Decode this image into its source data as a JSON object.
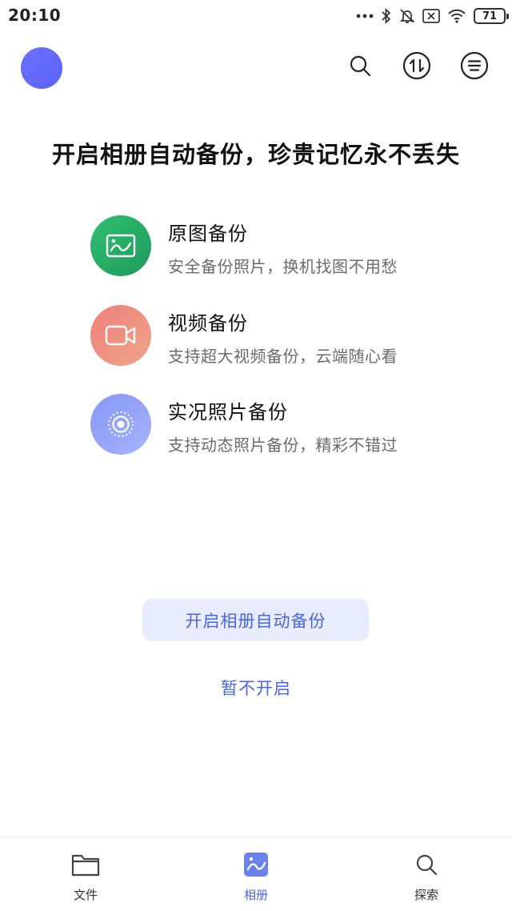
{
  "status_bar": {
    "time": "20:10",
    "battery": "71",
    "icons": [
      "more-dots-icon",
      "bluetooth-icon",
      "mute-bell-icon",
      "sim-x-icon",
      "wifi-icon",
      "battery-icon"
    ]
  },
  "header": {
    "avatar_color": "#6369fb",
    "actions": [
      "search-icon",
      "transfer-icon",
      "menu-icon"
    ]
  },
  "main": {
    "headline": "开启相册自动备份，珍贵记忆永不丢失",
    "features": [
      {
        "title": "原图备份",
        "description": "安全备份照片，换机找图不用愁",
        "icon": "image-icon",
        "color": "#22a863"
      },
      {
        "title": "视频备份",
        "description": "支持超大视频备份，云端随心看",
        "icon": "video-camera-icon",
        "color": "#ef8c7f"
      },
      {
        "title": "实况照片备份",
        "description": "支持动态照片备份，精彩不错过",
        "icon": "live-photo-icon",
        "color": "#95a5f8"
      }
    ],
    "primary_button": "开启相册自动备份",
    "secondary_link": "暂不开启"
  },
  "tab_bar": {
    "tabs": [
      {
        "label": "文件",
        "icon": "folder-icon",
        "active": false
      },
      {
        "label": "相册",
        "icon": "album-icon",
        "active": true
      },
      {
        "label": "探索",
        "icon": "explore-search-icon",
        "active": false
      }
    ]
  },
  "colors": {
    "accent": "#4a66e0",
    "button_bg": "#e8ecfd"
  }
}
